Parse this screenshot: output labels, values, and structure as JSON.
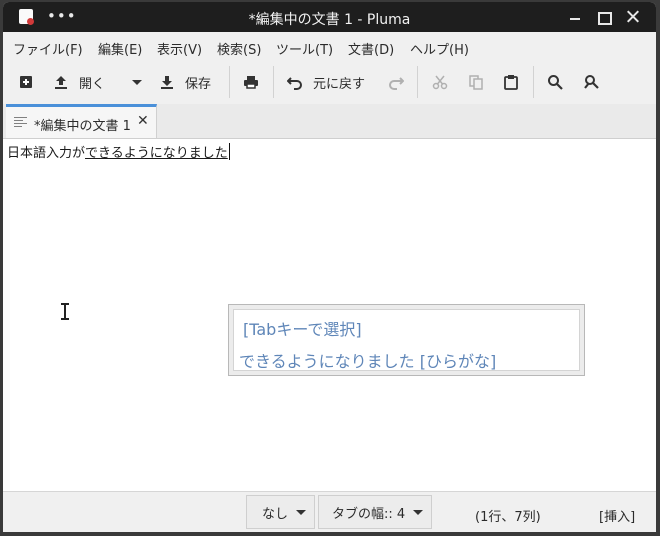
{
  "window": {
    "title": "*編集中の文書 1 - Pluma",
    "menu_dots": "•••"
  },
  "menubar": {
    "items": [
      "ファイル(F)",
      "編集(E)",
      "表示(V)",
      "検索(S)",
      "ツール(T)",
      "文書(D)",
      "ヘルプ(H)"
    ]
  },
  "toolbar": {
    "open_label": "開く",
    "save_label": "保存",
    "undo_label": "元に戻す"
  },
  "tab": {
    "label": "*編集中の文書 1",
    "close": "✕"
  },
  "editor": {
    "committed_text": "日本語入力が",
    "preedit_text": "できるようになりました"
  },
  "ime": {
    "hint": "[Tabキーで選択]",
    "candidate": "できるようになりました [ひらがな]"
  },
  "statusbar": {
    "highlight_mode": "なし",
    "tab_width": "タブの幅:: 4",
    "cursor_position": "(1行、7列)",
    "insert_mode": "[挿入]"
  }
}
